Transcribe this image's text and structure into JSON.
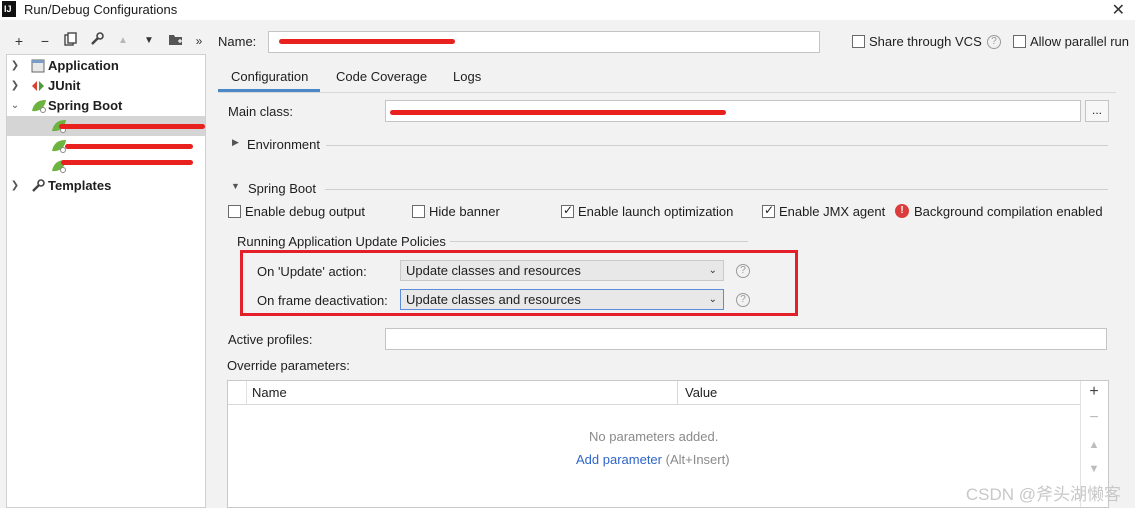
{
  "window": {
    "title": "Run/Debug Configurations",
    "logo_text": "IJ"
  },
  "toolbar": {
    "add": "+",
    "remove": "−",
    "copy": "⧉",
    "settings": "🔧",
    "move_up": "▲",
    "move_down": "▼",
    "folder": "📁",
    "more": "»"
  },
  "tree": {
    "items": [
      {
        "label": "Application",
        "expanded": false
      },
      {
        "label": "JUnit",
        "expanded": false
      },
      {
        "label": "Spring Boot",
        "expanded": true
      },
      {
        "label": "Templates",
        "expanded": false
      }
    ],
    "children": [
      {
        "label": "…",
        "redacted": true
      },
      {
        "label": "…",
        "redacted": true
      },
      {
        "label": "…",
        "redacted": true
      }
    ]
  },
  "header": {
    "name_label": "Name:",
    "name_value": "…",
    "share_vcs_label": "Share through VCS",
    "share_vcs_checked": false,
    "allow_parallel_label": "Allow parallel run",
    "allow_parallel_checked": false
  },
  "tabs": [
    {
      "label": "Configuration",
      "active": true
    },
    {
      "label": "Code Coverage",
      "active": false
    },
    {
      "label": "Logs",
      "active": false
    }
  ],
  "config": {
    "main_class_label": "Main class:",
    "main_class_value": "…",
    "browse_label": "...",
    "environment_label": "Environment",
    "spring_boot_label": "Spring Boot",
    "enable_debug_label": "Enable debug output",
    "enable_debug_checked": false,
    "hide_banner_label": "Hide banner",
    "hide_banner_checked": false,
    "launch_opt_label": "Enable launch optimization",
    "launch_opt_checked": true,
    "jmx_label": "Enable JMX agent",
    "jmx_checked": true,
    "bg_compile_label": "Background compilation enabled",
    "update_policies_label": "Running Application Update Policies",
    "on_update_label": "On 'Update' action:",
    "on_update_value": "Update classes and resources",
    "on_frame_label": "On frame deactivation:",
    "on_frame_value": "Update classes and resources",
    "active_profiles_label": "Active profiles:",
    "active_profiles_value": "",
    "override_label": "Override parameters:"
  },
  "params_table": {
    "columns": [
      "Name",
      "Value"
    ],
    "empty_text": "No parameters added.",
    "add_link": "Add parameter",
    "add_shortcut": "(Alt+Insert)"
  },
  "watermark": "CSDN @斧头湖懒客",
  "colors": {
    "accent": "#4a88c7",
    "highlight_border": "#e3202a",
    "link": "#2f65ca",
    "warning": "#db3c3c"
  }
}
